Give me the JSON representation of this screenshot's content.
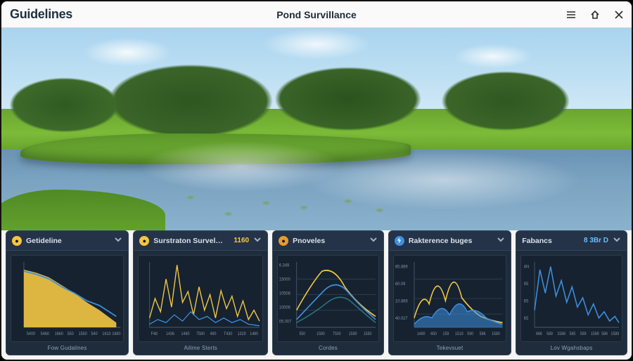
{
  "header": {
    "title_left": "Guidelines",
    "title_center": "Pond Survillance",
    "icons": {
      "menu": "menu-icon",
      "home": "home-icon",
      "close": "close-icon"
    }
  },
  "colors": {
    "panel_bg": "#1e2c3c",
    "panel_head": "#243347",
    "accent_yellow": "#f5c542",
    "accent_orange": "#e79a2e",
    "accent_blue": "#3d8fe0",
    "line_blue": "#3d8fe0",
    "line_yellow": "#f2c744",
    "line_teal": "#2f7d8a",
    "fill_yellow": "#f2c744"
  },
  "panels": [
    {
      "id": "guidelines",
      "dot_color": "yellow",
      "name": "Getideline",
      "value": "",
      "footer": "Fow Gudalines",
      "chart_kind": "area-yellow"
    },
    {
      "id": "surveillance",
      "dot_color": "yellow",
      "name": "Surstraton Survelance",
      "value": "1160",
      "footer": "Ailime Sterts",
      "chart_kind": "spiky-yellow-blue"
    },
    {
      "id": "pnoveles",
      "dot_color": "orange",
      "name": "Pnoveles",
      "value": "",
      "footer": "Cordes",
      "chart_kind": "multi-curve"
    },
    {
      "id": "reference",
      "dot_color": "blue",
      "name": "Rakterence buges",
      "value": "",
      "footer": "Tekevsuet",
      "chart_kind": "double-wave"
    },
    {
      "id": "fabancs",
      "dot_color": "",
      "name": "Fabancs",
      "value": "8 3Br D",
      "value_color": "blue",
      "footer": "Lov Wgahsbaps",
      "chart_kind": "jagged-blue"
    }
  ],
  "chart_data": [
    {
      "panel": "guidelines",
      "type": "area",
      "x": [
        "5400",
        "5460",
        "1660",
        "550",
        "1590",
        "540",
        "1610",
        "1680"
      ],
      "ylim": [
        0,
        100
      ],
      "series": [
        {
          "name": "fill",
          "color": "#f2c744",
          "values": [
            88,
            84,
            80,
            70,
            60,
            48,
            40,
            18
          ]
        },
        {
          "name": "line",
          "color": "#3d8fe0",
          "values": [
            86,
            82,
            78,
            68,
            60,
            50,
            44,
            30
          ]
        }
      ]
    },
    {
      "panel": "surveillance",
      "type": "line",
      "x": [
        "F48",
        "1436",
        "1480",
        "7580",
        "490",
        "T430",
        "1329",
        "1480"
      ],
      "ylim": [
        0,
        100
      ],
      "series": [
        {
          "name": "yellow",
          "color": "#f2c744",
          "values": [
            20,
            45,
            30,
            70,
            35,
            90,
            40,
            55,
            25,
            60,
            30,
            50,
            20
          ]
        },
        {
          "name": "blue",
          "color": "#3d8fe0",
          "values": [
            10,
            18,
            12,
            25,
            14,
            30,
            16,
            22,
            12,
            20,
            10,
            15,
            8
          ]
        }
      ]
    },
    {
      "panel": "pnoveles",
      "type": "line",
      "x": [
        "550",
        "1580",
        "7500",
        "1590",
        "1550"
      ],
      "yticks": [
        "6.349",
        "15000",
        "10508",
        "10006",
        "05.007"
      ],
      "ylim": [
        0,
        100
      ],
      "series": [
        {
          "name": "yellow",
          "color": "#f2c744",
          "values": [
            30,
            62,
            85,
            78,
            58,
            40,
            30,
            25
          ]
        },
        {
          "name": "blue",
          "color": "#3d8fe0",
          "values": [
            15,
            35,
            55,
            72,
            60,
            42,
            28,
            18
          ]
        },
        {
          "name": "teal",
          "color": "#2f7d8a",
          "values": [
            10,
            20,
            32,
            46,
            52,
            40,
            26,
            14
          ]
        }
      ]
    },
    {
      "panel": "reference",
      "type": "line",
      "x": [
        "1480",
        "650",
        "159",
        "1519",
        "590",
        "586",
        "1580"
      ],
      "yticks": [
        "85.889",
        "60.09",
        "10.889",
        "40.027"
      ],
      "ylim": [
        0,
        100
      ],
      "series": [
        {
          "name": "yellow",
          "color": "#f2c744",
          "values": [
            20,
            55,
            35,
            82,
            40,
            88,
            45,
            30,
            20,
            15
          ]
        },
        {
          "name": "blue",
          "color": "#3d8fe0",
          "values": [
            10,
            25,
            18,
            40,
            22,
            48,
            26,
            34,
            18,
            10
          ]
        }
      ]
    },
    {
      "panel": "fabancs",
      "type": "line",
      "x": [
        "686",
        "589",
        "1588",
        "585",
        "599",
        "1589",
        "588",
        "1589"
      ],
      "yticks": [
        "4N",
        "95",
        "85",
        "65"
      ],
      "ylim": [
        0,
        100
      ],
      "series": [
        {
          "name": "blue",
          "color": "#3d8fe0",
          "values": [
            30,
            85,
            55,
            90,
            50,
            70,
            40,
            60,
            35,
            45,
            25,
            38,
            20,
            28,
            15
          ]
        }
      ]
    }
  ]
}
